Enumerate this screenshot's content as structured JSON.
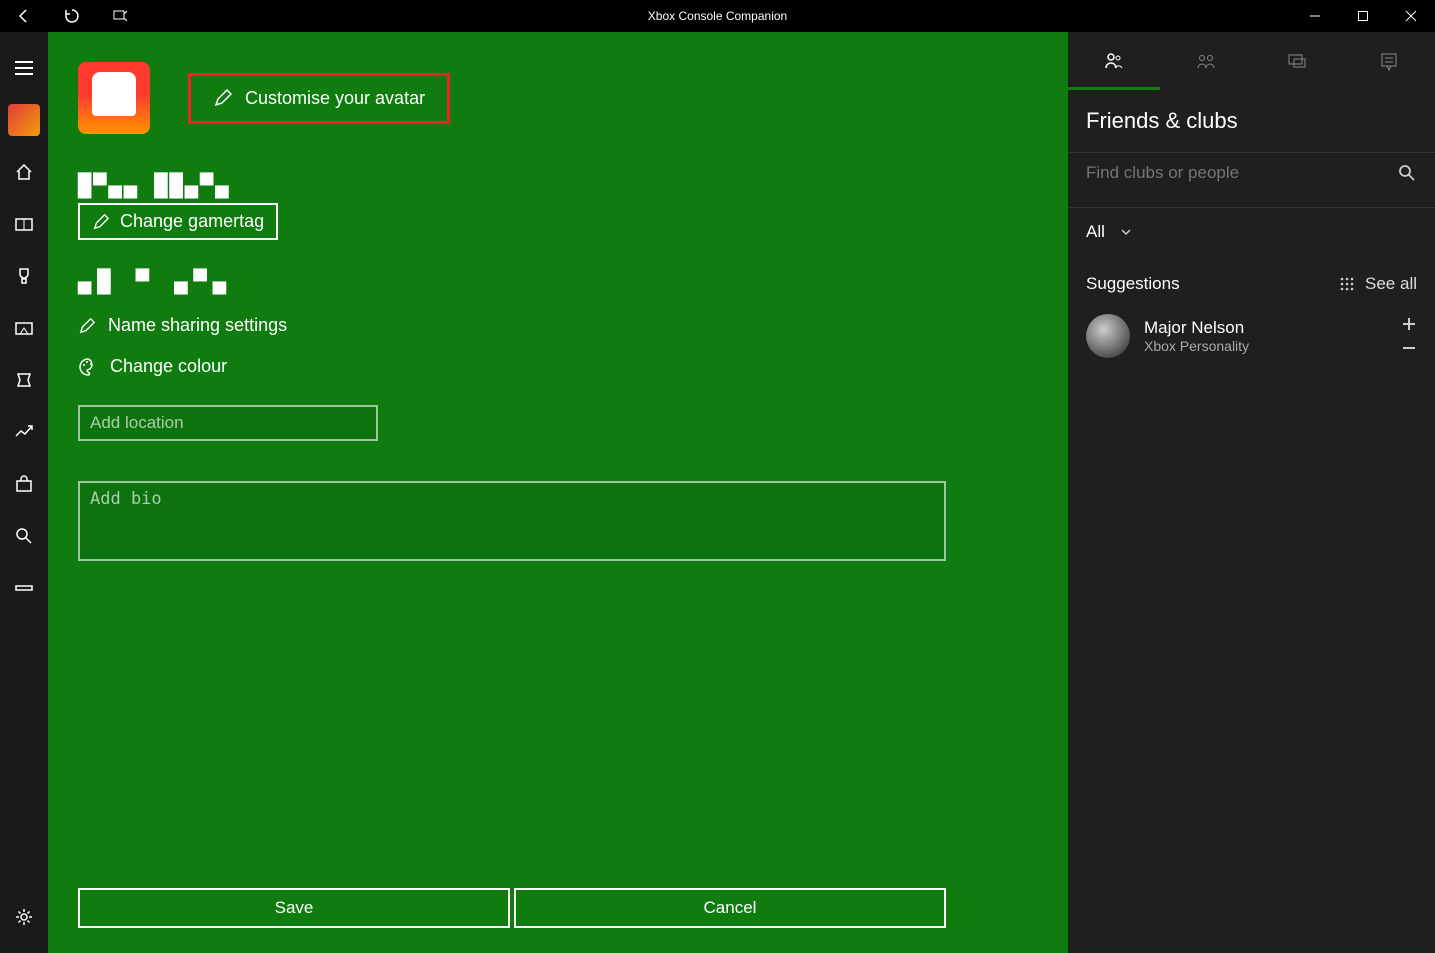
{
  "window": {
    "title": "Xbox Console Companion"
  },
  "profile": {
    "customise_label": "Customise your avatar",
    "gamertag": "█▀▄▄ ██▄▀▄",
    "change_gamertag": "Change gamertag",
    "real_name": "▄█ ▀ ▄▀▄",
    "name_sharing": "Name sharing settings",
    "change_colour": "Change colour",
    "location_placeholder": "Add location",
    "bio_placeholder": "Add bio",
    "save_label": "Save",
    "cancel_label": "Cancel"
  },
  "friends": {
    "title": "Friends & clubs",
    "search_placeholder": "Find clubs or people",
    "filter": "All",
    "suggestions_label": "Suggestions",
    "see_all": "See all",
    "items": [
      {
        "name": "Major Nelson",
        "sub": "Xbox Personality"
      }
    ]
  }
}
